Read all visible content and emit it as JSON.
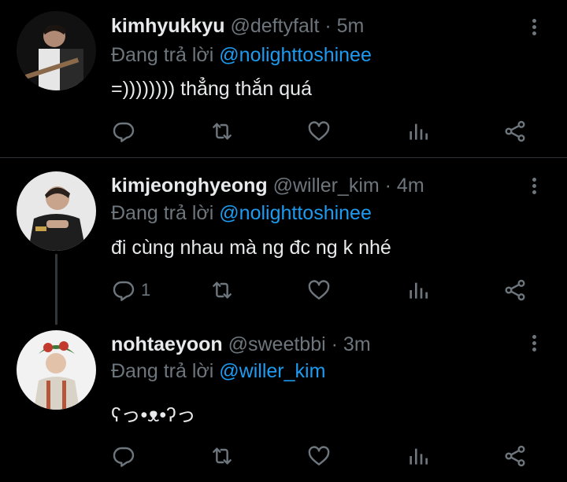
{
  "tweets": [
    {
      "name": "kimhyukkyu",
      "handle": "@deftyfalt",
      "time": "· 5m",
      "reply_prefix": "Đang trả lời",
      "reply_to": "@nolighttoshinee",
      "text": "=)))))))) thẳng thắn quá",
      "reply_count": ""
    },
    {
      "name": "kimjeonghyeong",
      "handle": "@willer_kim",
      "time": "· 4m",
      "reply_prefix": "Đang trả lời",
      "reply_to": "@nolighttoshinee",
      "text": "đi cùng nhau mà ng đc ng k nhé",
      "reply_count": "1"
    },
    {
      "name": "nohtaeyoon",
      "handle": "@sweetbbi",
      "time": "· 3m",
      "reply_prefix": "Đang trả lời",
      "reply_to": "@willer_kim",
      "text": "ʕっ•ᴥ•ʔっ",
      "reply_count": ""
    }
  ],
  "icons": [
    "more-vertical-icon",
    "reply-icon",
    "retweet-icon",
    "like-icon",
    "analytics-icon",
    "share-icon"
  ],
  "colors": {
    "background": "#000000",
    "mention": "#1d9bf0",
    "secondary": "#6e767d",
    "text": "#e7e9ea"
  }
}
